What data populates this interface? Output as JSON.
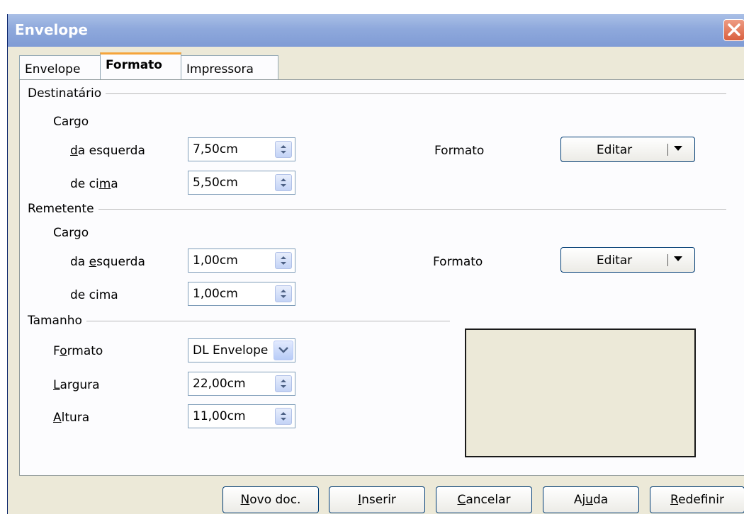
{
  "window": {
    "title": "Envelope"
  },
  "tabs": [
    {
      "label": "Envelope",
      "active": false
    },
    {
      "label": "Formato",
      "active": true
    },
    {
      "label": "Impressora",
      "active": false
    }
  ],
  "recipient": {
    "group_label": "Destinatário",
    "position_label": "Cargo",
    "left": {
      "label_underlined": "d",
      "label_rest": "a esquerda",
      "value": "7,50cm"
    },
    "top": {
      "label_before": "de ci",
      "label_underlined": "m",
      "label_after": "a",
      "value": "5,50cm"
    },
    "format_label": "Formato",
    "edit_button": "Editar"
  },
  "sender": {
    "group_label": "Remetente",
    "position_label": "Cargo",
    "left": {
      "label_before": "da ",
      "label_underlined": "e",
      "label_after": "squerda",
      "value": "1,00cm"
    },
    "top": {
      "label": "de cima",
      "value": "1,00cm"
    },
    "format_label": "Formato",
    "edit_button": "Editar"
  },
  "size": {
    "group_label": "Tamanho",
    "format": {
      "label_before": "F",
      "label_underlined": "o",
      "label_after": "rmato",
      "value": "DL Envelope"
    },
    "width": {
      "label_underlined": "L",
      "label_rest": "argura",
      "value": "22,00cm"
    },
    "height": {
      "label_underlined": "A",
      "label_rest": "ltura",
      "value": "11,00cm"
    }
  },
  "buttons": {
    "new_doc": {
      "underlined": "N",
      "rest": "ovo doc."
    },
    "insert": {
      "underlined": "I",
      "rest": "nserir"
    },
    "cancel": {
      "underlined": "C",
      "rest": "ancelar"
    },
    "help": {
      "before": "Aj",
      "underlined": "u",
      "after": "da"
    },
    "reset": {
      "underlined": "R",
      "rest": "edefinir"
    }
  },
  "colors": {
    "dialog_bg": "#ece9d8",
    "titlebar": "#8fa9dc",
    "active_tab_accent": "#f5a43b",
    "close_button": "#d9603f"
  }
}
